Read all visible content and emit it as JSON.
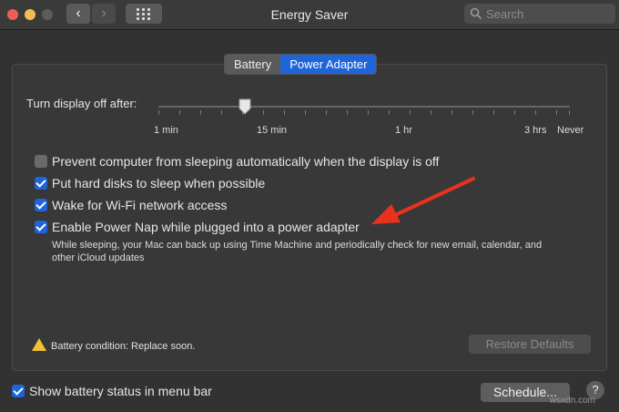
{
  "window": {
    "title": "Energy Saver"
  },
  "search": {
    "placeholder": "Search"
  },
  "tabs": [
    {
      "label": "Battery",
      "active": false
    },
    {
      "label": "Power Adapter",
      "active": true
    }
  ],
  "slider": {
    "label": "Turn display off after:",
    "value_label": "15 min",
    "ticks": [
      "1 min",
      "15 min",
      "1 hr",
      "3 hrs",
      "Never"
    ]
  },
  "options": [
    {
      "label": "Prevent computer from sleeping automatically when the display is off",
      "checked": false
    },
    {
      "label": "Put hard disks to sleep when possible",
      "checked": true
    },
    {
      "label": "Wake for Wi-Fi network access",
      "checked": true
    },
    {
      "label": "Enable Power Nap while plugged into a power adapter",
      "checked": true
    }
  ],
  "power_nap_description": "While sleeping, your Mac can back up using Time Machine and periodically check for new email, calendar, and other iCloud updates",
  "battery_condition": "Battery condition: Replace soon.",
  "buttons": {
    "restore": "Restore Defaults",
    "schedule": "Schedule...",
    "help": "?"
  },
  "show_battery": {
    "label": "Show battery status in menu bar",
    "checked": true
  },
  "watermark": "wsxdn.com",
  "colors": {
    "accent": "#1f64d8",
    "annotation_arrow": "#e8321e",
    "warning": "#f2c037"
  },
  "icons": {
    "back": "chevron-left-icon",
    "forward": "chevron-right-icon",
    "grid": "grid-icon",
    "search": "search-icon",
    "warning": "warning-icon"
  }
}
